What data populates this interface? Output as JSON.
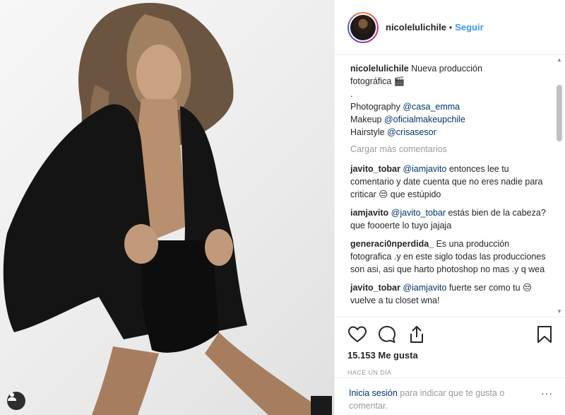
{
  "header": {
    "username": "nicolelulichile",
    "separator": "•",
    "follow_label": "Seguir"
  },
  "caption": {
    "username": "nicolelulichile",
    "lines": [
      "Nueva producción",
      "fotográfica 🎬",
      ".",
      "Photography ",
      "Makeup ",
      "Hairstyle "
    ],
    "mentions": [
      "@casa_emma",
      "@oficialmakeupchile",
      "@crisasesor"
    ]
  },
  "load_more_label": "Cargar más comentarios",
  "comments": [
    {
      "username": "javito_tobar",
      "mention": "@iamjavito",
      "text": " entonces lee tu comentario y date cuenta que no eres nadie para criticar 😒 que estúpido"
    },
    {
      "username": "iamjavito",
      "mention": "@javito_tobar",
      "text": " estás bien de la cabeza? que foooerte lo tuyo jajaja"
    },
    {
      "username": "generaci0nperdida_",
      "mention": "",
      "text": " Es una producción fotografica .y en este siglo todas las producciones son asi, asi que harto photoshop no mas .y q wea"
    },
    {
      "username": "javito_tobar",
      "mention": "@iamjavito",
      "text": " fuerte ser como tu 😒 vuelve a tu closet wna!"
    }
  ],
  "likes": "15.153 Me gusta",
  "timestamp": "HACE UN DÍA",
  "login": {
    "link": "Inicia sesión",
    "text": " para indicar que te gusta o comentar.",
    "more": "···"
  },
  "scrollbar": {
    "up": "▲",
    "down": "▼"
  },
  "icons": {
    "like": "heart-icon",
    "comment": "comment-icon",
    "share": "share-icon",
    "save": "bookmark-icon",
    "user_tag": "user-tag-icon"
  },
  "colors": {
    "link_blue": "#3897f0",
    "mention_blue": "#003569",
    "muted_gray": "#999999",
    "text": "#262626"
  }
}
